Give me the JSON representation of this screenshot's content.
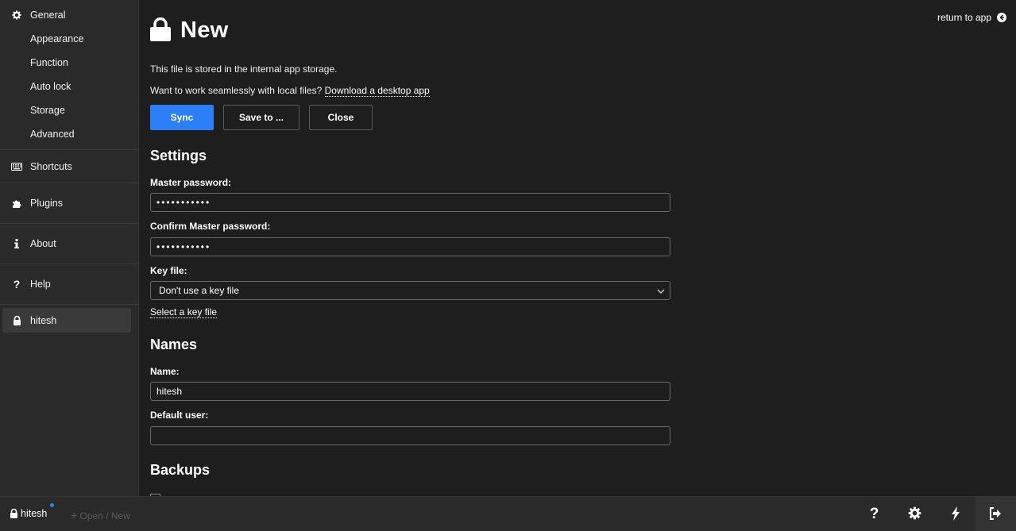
{
  "sidebar": {
    "general": "General",
    "sub_items": [
      "Appearance",
      "Function",
      "Auto lock",
      "Storage",
      "Advanced"
    ],
    "shortcuts": "Shortcuts",
    "plugins": "Plugins",
    "about": "About",
    "help": "Help",
    "user": "hitesh"
  },
  "header": {
    "return_label": "return to app",
    "title": "New"
  },
  "info": {
    "storage_text": "This file is stored in the internal app storage.",
    "desktop_prompt": "Want to work seamlessly with local files?",
    "desktop_link": "Download a desktop app"
  },
  "buttons": {
    "sync": "Sync",
    "save_to": "Save to ...",
    "close": "Close"
  },
  "settings": {
    "heading": "Settings",
    "master_password_label": "Master password:",
    "master_password_value": "•••••••••••",
    "confirm_password_label": "Confirm Master password:",
    "confirm_password_value": "•••••••••••",
    "key_file_label": "Key file:",
    "key_file_selected": "Don't use a key file",
    "select_key_file": "Select a key file"
  },
  "names": {
    "heading": "Names",
    "name_label": "Name:",
    "name_value": "hitesh",
    "default_user_label": "Default user:",
    "default_user_value": ""
  },
  "backups": {
    "heading": "Backups"
  },
  "footer": {
    "user": "hitesh",
    "open_new": "Open / New"
  },
  "colors": {
    "accent": "#2d7ff9",
    "background": "#1e1e1e",
    "panel": "#2a2a2a"
  }
}
